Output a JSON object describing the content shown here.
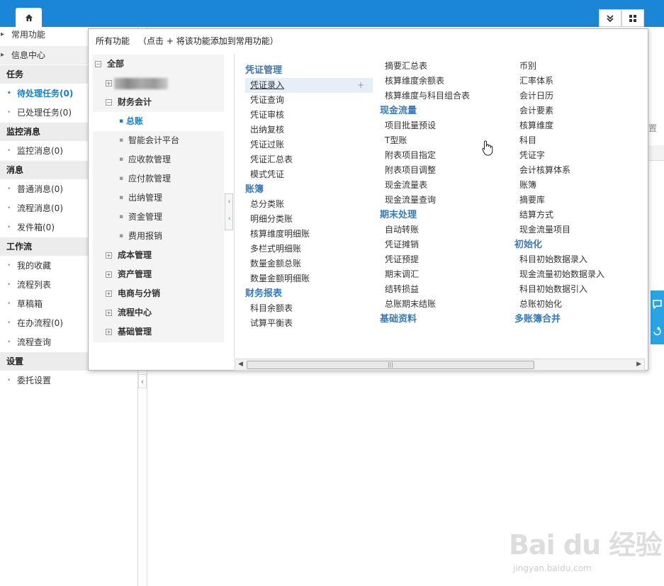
{
  "header": {
    "home_icon": "home-icon",
    "collapse_icon": "double-chevron-down-icon",
    "apps_icon": "grid-icon"
  },
  "sidebar": {
    "common": "常用功能",
    "info_center": "信息中心",
    "groups": [
      {
        "title": "任务",
        "items": [
          "待处理任务(0)",
          "已处理任务(0)"
        ]
      },
      {
        "title": "监控消息",
        "items": [
          "监控消息(0)"
        ]
      },
      {
        "title": "消息",
        "items": [
          "普通消息(0)",
          "流程消息(0)",
          "发件箱(0)"
        ]
      },
      {
        "title": "工作流",
        "items": [
          "我的收藏",
          "流程列表",
          "草稿箱",
          "在办流程(0)",
          "流程查询"
        ]
      },
      {
        "title": "设置",
        "items": [
          "委托设置"
        ]
      }
    ],
    "collapse_glyph": "‹"
  },
  "main": {
    "tab_text": "置"
  },
  "popup": {
    "title": "所有功能",
    "hint": "（点击 + 将该功能添加到常用功能）",
    "tree": {
      "root": "全部",
      "finance": "财务会计",
      "finance_children": [
        "总账",
        "智能会计平台",
        "应收款管理",
        "应付款管理",
        "出纳管理",
        "资金管理",
        "费用报销"
      ],
      "others": [
        "成本管理",
        "资产管理",
        "电商与分销",
        "流程中心",
        "基础管理"
      ]
    },
    "col1": [
      {
        "h": "凭证管理",
        "items": [
          "凭证录入",
          "凭证查询",
          "凭证审核",
          "出纳复核",
          "凭证过账",
          "凭证汇总表",
          "模式凭证"
        ]
      },
      {
        "h": "账簿",
        "items": [
          "总分类账",
          "明细分类账",
          "核算维度明细账",
          "多栏式明细账",
          "数量金额总账",
          "数量金额明细账"
        ]
      },
      {
        "h": "财务报表",
        "items": [
          "科目余额表",
          "试算平衡表"
        ]
      }
    ],
    "col2": [
      {
        "h": "",
        "items": [
          "摘要汇总表",
          "核算维度余额表",
          "核算维度与科目组合表"
        ]
      },
      {
        "h": "现金流量",
        "items": [
          "项目批量预设",
          "T型账",
          "附表项目指定",
          "附表项目调整",
          "现金流量表",
          "现金流量查询"
        ]
      },
      {
        "h": "期末处理",
        "items": [
          "自动转账",
          "凭证摊销",
          "凭证预提",
          "期末调汇",
          "结转损益",
          "总账期末结账"
        ]
      },
      {
        "h": "基础资料",
        "items": []
      }
    ],
    "col3": [
      {
        "h": "",
        "items": [
          "币别",
          "汇率体系",
          "会计日历",
          "会计要素",
          "核算维度",
          "科目",
          "凭证字",
          "会计核算体系",
          "账簿",
          "摘要库",
          "结算方式",
          "现金流量项目"
        ]
      },
      {
        "h": "初始化",
        "items": [
          "科目初始数据录入",
          "现金流量初始数据录入",
          "科目初始数据引入",
          "总账初始化"
        ]
      },
      {
        "h": "多账簿合并",
        "items": []
      }
    ],
    "add_symbol": "+"
  },
  "watermark": {
    "logo": "Bai du 经验",
    "url": "jingyan.baidu.com"
  }
}
